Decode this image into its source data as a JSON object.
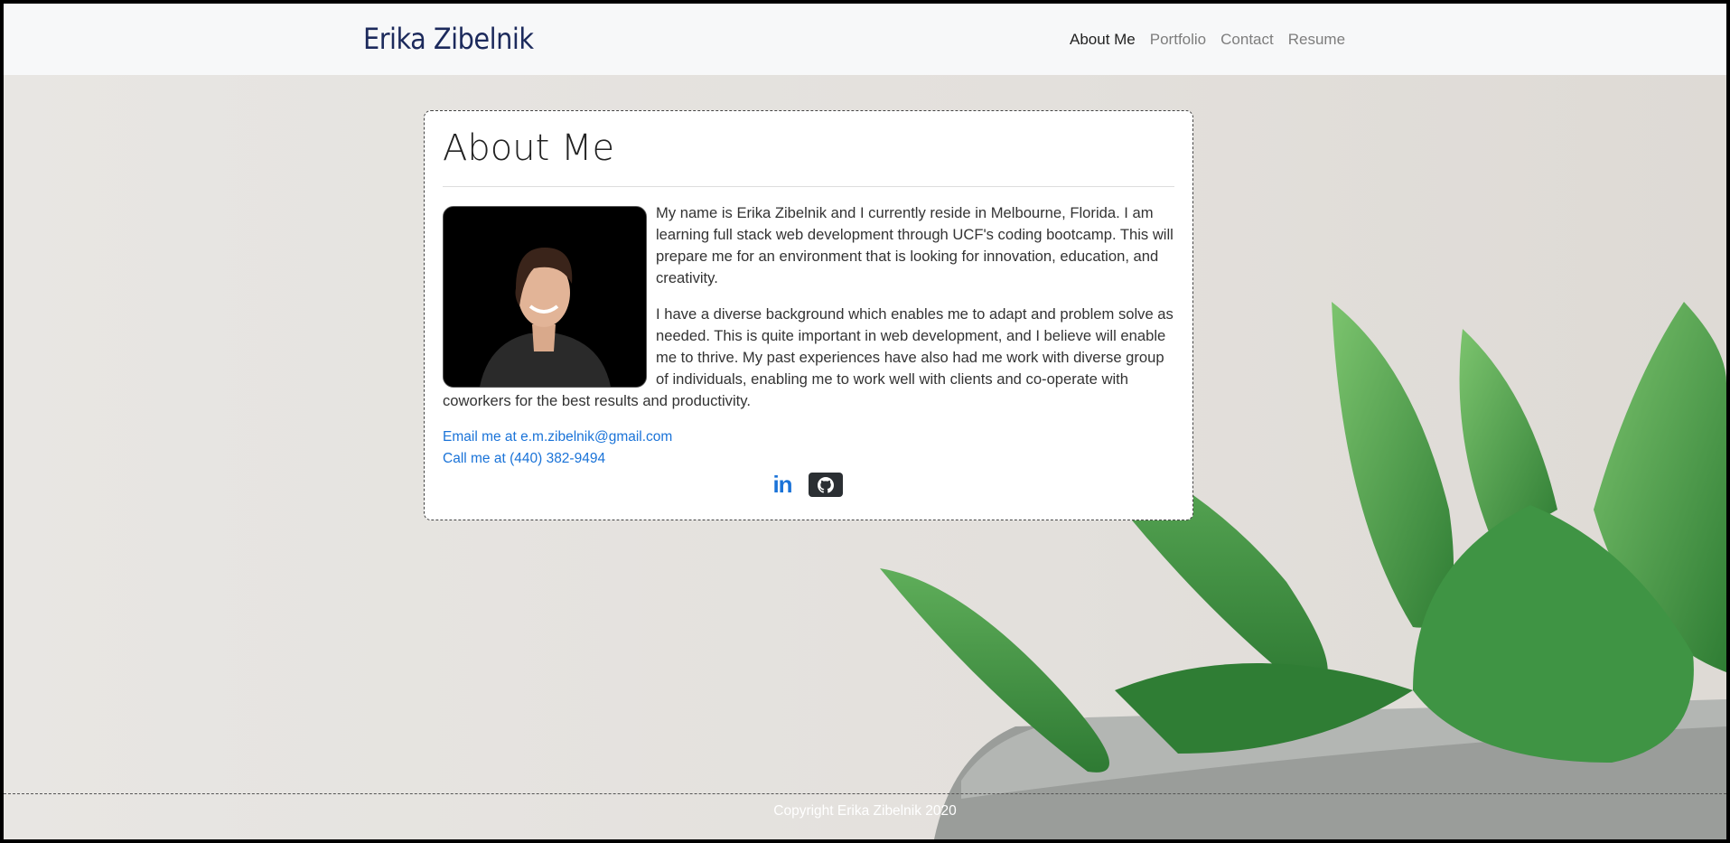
{
  "navbar": {
    "brand": "Erika Zibelnik",
    "links": [
      "About Me",
      "Portfolio",
      "Contact",
      "Resume"
    ],
    "active": "About Me"
  },
  "about": {
    "heading": "About Me",
    "paragraphs": [
      "My name is Erika Zibelnik and I currently reside in Melbourne, Florida. I am learning full stack web development through UCF's coding bootcamp. This will prepare me for an environment that is looking for innovation, education, and creativity.",
      "I have a diverse background which enables me to adapt and problem solve as needed. This is quite important in web development, and I believe will enable me to thrive. My past experiences have also had me work with diverse group of individuals, enabling me to work well with clients and co-operate with coworkers for the best results and productivity."
    ],
    "email_link": "Email me at e.m.zibelnik@gmail.com",
    "phone_link": "Call me at (440) 382-9494",
    "social": {
      "linkedin_icon": "in",
      "github_icon": "github-icon"
    }
  },
  "footer": {
    "copyright": "Copyright Erika Zibelnik 2020"
  },
  "colors": {
    "brand": "#1c2a5c",
    "link": "#1a73d8",
    "footer_text": "#ffffff"
  }
}
